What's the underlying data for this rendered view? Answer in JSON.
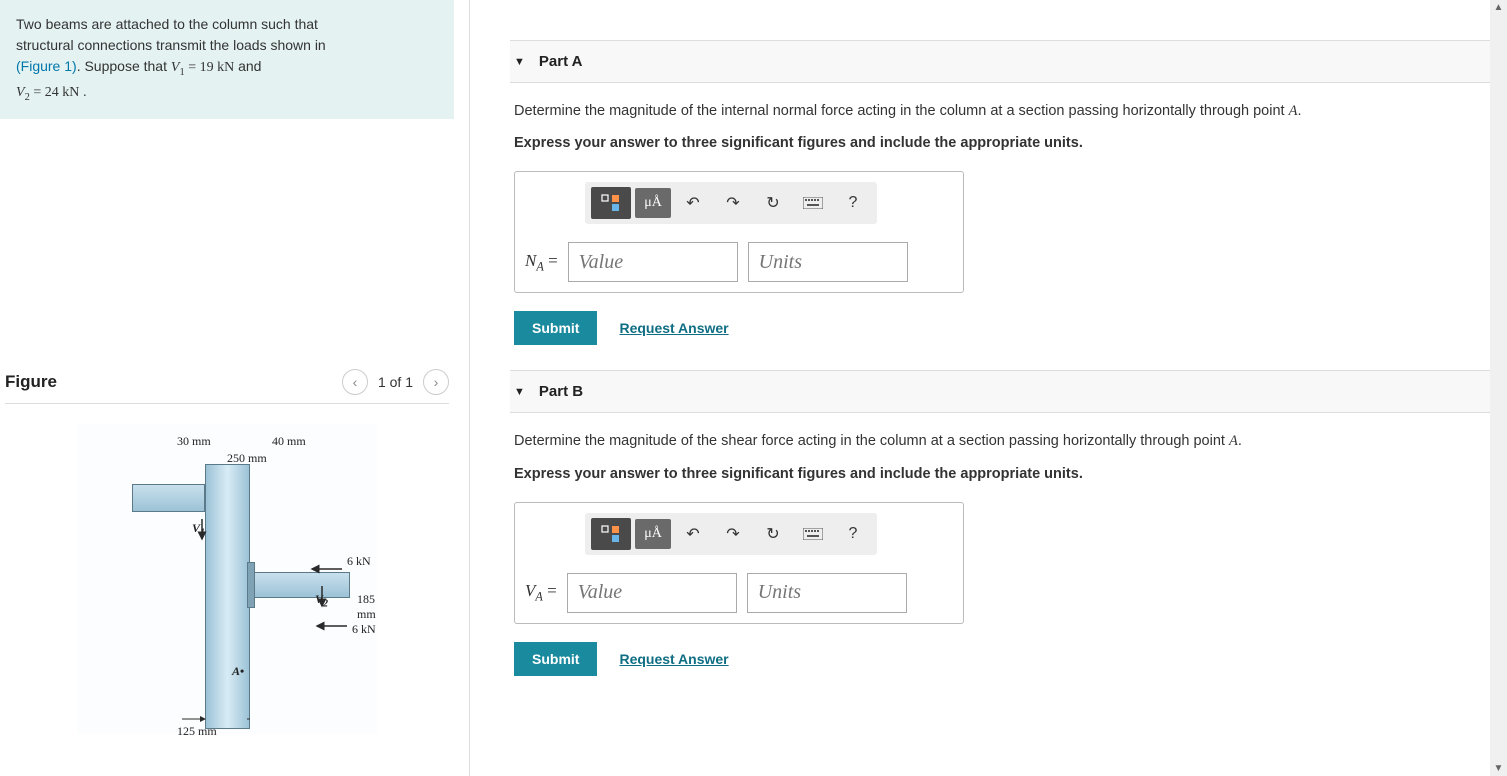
{
  "problem": {
    "line1": "Two beams are attached to the column such that",
    "line2": "structural connections transmit the loads shown in",
    "figure_link": "(Figure 1)",
    "suppose": ". Suppose that ",
    "v1_var": "V",
    "v1_sub": "1",
    "eq": " = ",
    "v1_val": "19",
    "v1_unit": " kN",
    "and": " and",
    "v2_var": "V",
    "v2_sub": "2",
    "v2_val": "24",
    "v2_unit": " kN ",
    "period": "."
  },
  "figure": {
    "title": "Figure",
    "page": "1 of 1",
    "labels": {
      "d30": "30 mm",
      "d40": "40 mm",
      "d250": "250 mm",
      "d125": "125 mm",
      "d185": "185 mm",
      "f6a": "6 kN",
      "f6b": "6 kN",
      "V1": "V",
      "V1sub": "1",
      "V2": "V",
      "V2sub": "2",
      "A": "A"
    }
  },
  "parts": {
    "A": {
      "title": "Part A",
      "question_pre": "Determine the magnitude of the internal normal force acting in the column at a section passing horizontally through point ",
      "question_var": "A",
      "question_post": ".",
      "instruction": "Express your answer to three significant figures and include the appropriate units.",
      "var_letter": "N",
      "var_sub": "A",
      "value_ph": "Value",
      "units_ph": "Units",
      "submit": "Submit",
      "request": "Request Answer",
      "mu_label": "μÅ"
    },
    "B": {
      "title": "Part B",
      "question_pre": "Determine the magnitude of the shear force acting in the column at a section passing horizontally through point ",
      "question_var": "A",
      "question_post": ".",
      "instruction": "Express your answer to three significant figures and include the appropriate units.",
      "var_letter": "V",
      "var_sub": "A",
      "value_ph": "Value",
      "units_ph": "Units",
      "submit": "Submit",
      "request": "Request Answer",
      "mu_label": "μÅ"
    }
  },
  "toolbar": {
    "help": "?"
  }
}
